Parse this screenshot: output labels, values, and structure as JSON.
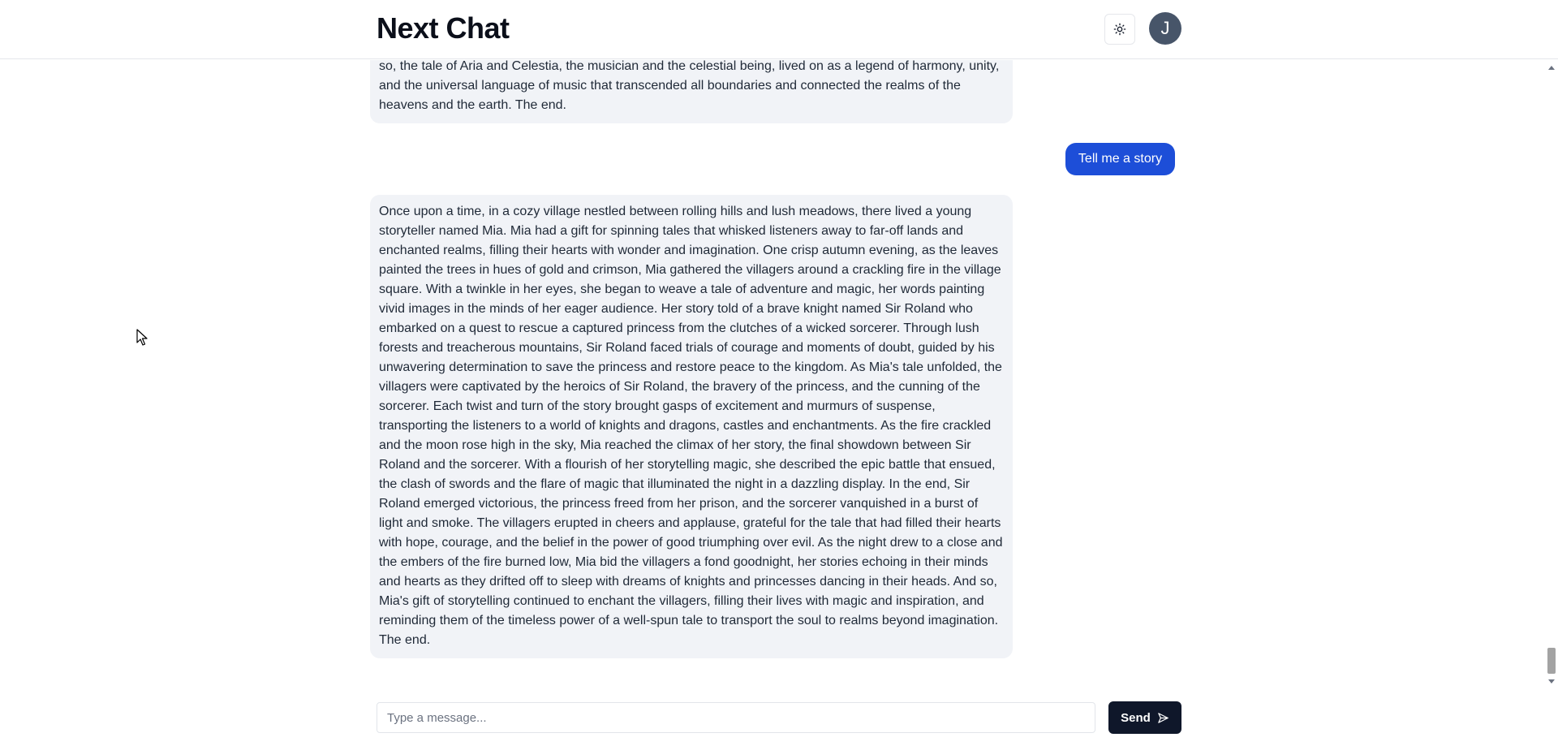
{
  "header": {
    "title": "Next Chat",
    "theme_toggle_icon": "sun-icon",
    "avatar_initial": "J"
  },
  "messages": [
    {
      "role": "assistant",
      "text": "so, the tale of Aria and Celestia, the musician and the celestial being, lived on as a legend of harmony, unity, and the universal language of music that transcended all boundaries and connected the realms of the heavens and the earth. The end."
    },
    {
      "role": "user",
      "text": "Tell me a story"
    },
    {
      "role": "assistant",
      "text": "Once upon a time, in a cozy village nestled between rolling hills and lush meadows, there lived a young storyteller named Mia. Mia had a gift for spinning tales that whisked listeners away to far-off lands and enchanted realms, filling their hearts with wonder and imagination. One crisp autumn evening, as the leaves painted the trees in hues of gold and crimson, Mia gathered the villagers around a crackling fire in the village square. With a twinkle in her eyes, she began to weave a tale of adventure and magic, her words painting vivid images in the minds of her eager audience. Her story told of a brave knight named Sir Roland who embarked on a quest to rescue a captured princess from the clutches of a wicked sorcerer. Through lush forests and treacherous mountains, Sir Roland faced trials of courage and moments of doubt, guided by his unwavering determination to save the princess and restore peace to the kingdom. As Mia's tale unfolded, the villagers were captivated by the heroics of Sir Roland, the bravery of the princess, and the cunning of the sorcerer. Each twist and turn of the story brought gasps of excitement and murmurs of suspense, transporting the listeners to a world of knights and dragons, castles and enchantments. As the fire crackled and the moon rose high in the sky, Mia reached the climax of her story, the final showdown between Sir Roland and the sorcerer. With a flourish of her storytelling magic, she described the epic battle that ensued, the clash of swords and the flare of magic that illuminated the night in a dazzling display. In the end, Sir Roland emerged victorious, the princess freed from her prison, and the sorcerer vanquished in a burst of light and smoke. The villagers erupted in cheers and applause, grateful for the tale that had filled their hearts with hope, courage, and the belief in the power of good triumphing over evil. As the night drew to a close and the embers of the fire burned low, Mia bid the villagers a fond goodnight, her stories echoing in their minds and hearts as they drifted off to sleep with dreams of knights and princesses dancing in their heads. And so, Mia's gift of storytelling continued to enchant the villagers, filling their lives with magic and inspiration, and reminding them of the timeless power of a well-spun tale to transport the soul to realms beyond imagination. The end."
    }
  ],
  "composer": {
    "placeholder": "Type a message...",
    "value": "",
    "send_label": "Send",
    "send_icon": "send-icon"
  },
  "colors": {
    "user_bubble": "#1d4ed8",
    "assistant_bubble": "#f1f3f7",
    "send_button": "#0f172a",
    "avatar": "#475569"
  }
}
